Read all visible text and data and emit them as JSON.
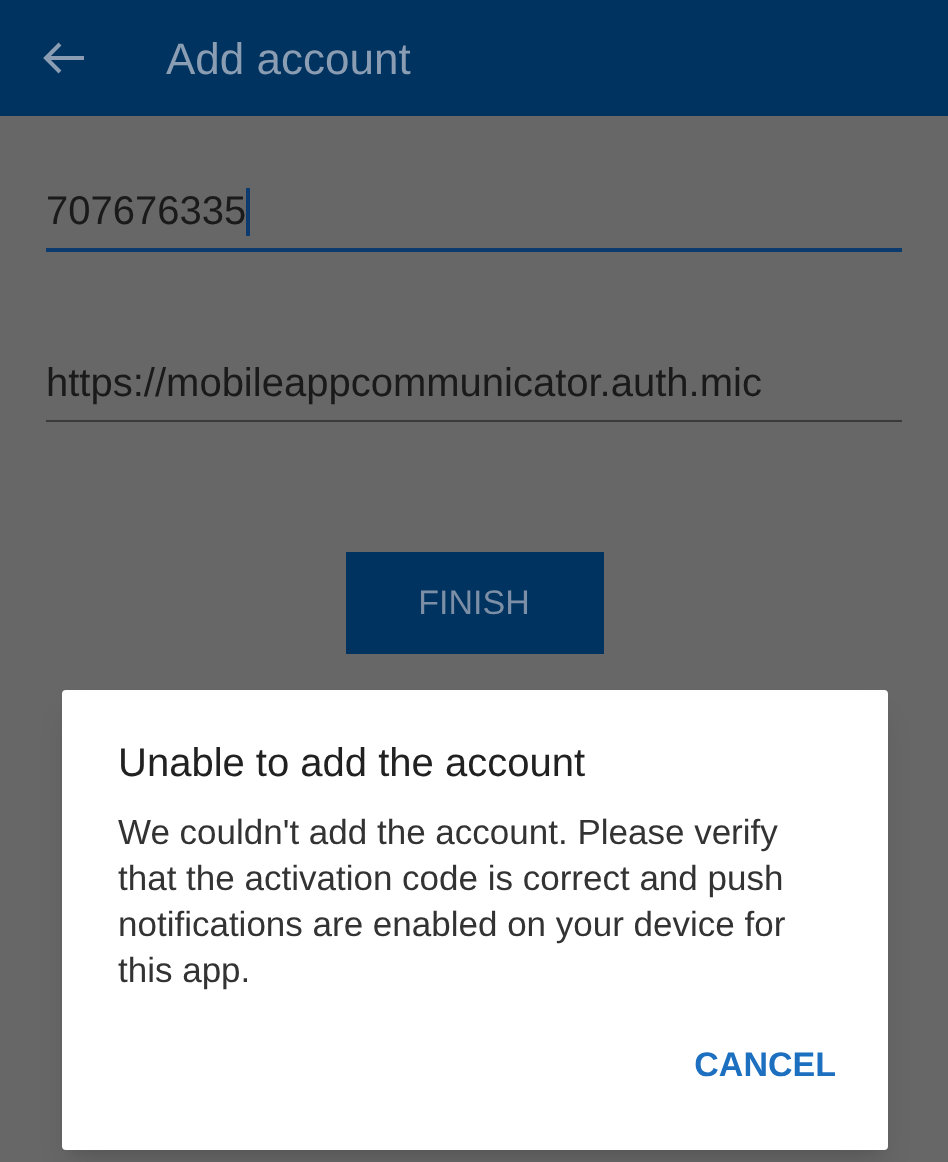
{
  "app_bar": {
    "title": "Add account"
  },
  "fields": [
    {
      "value": "707676335",
      "focused": true
    },
    {
      "value": "https://mobileappcommunicator.auth.mic",
      "focused": false
    }
  ],
  "finish_button": {
    "label": "FINISH"
  },
  "dialog": {
    "title": "Unable to add the account",
    "message": "We couldn't add the account. Please verify that the activation code is correct and push notifications are enabled on your device for this app.",
    "buttons": [
      "CANCEL"
    ]
  }
}
